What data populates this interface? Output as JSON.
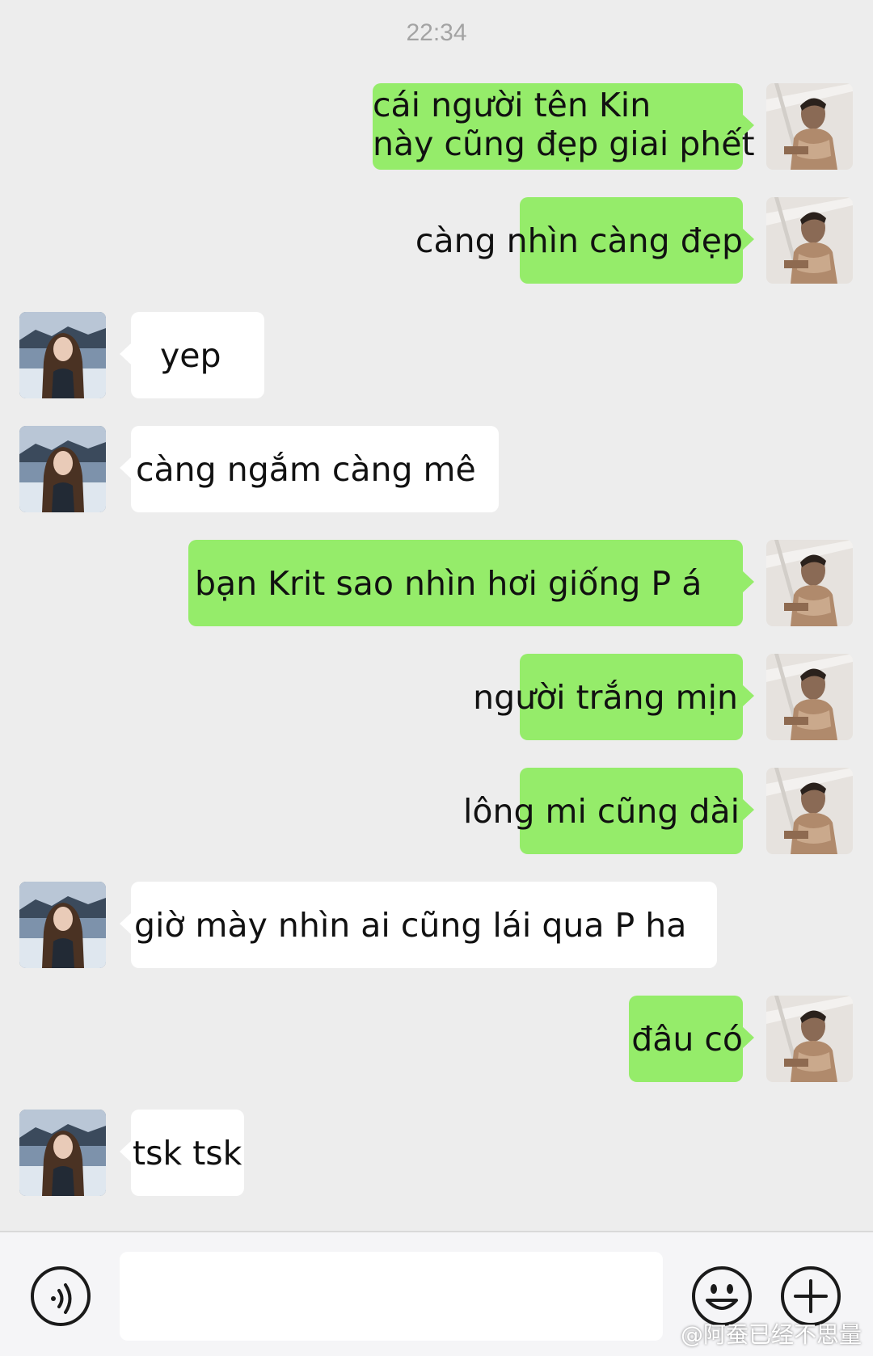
{
  "chat": {
    "timestamp": "22:34",
    "messages": [
      {
        "sender": "me",
        "lines": [
          "cái người tên Kin",
          "này cũng đẹp giai phết"
        ]
      },
      {
        "sender": "me",
        "text": "càng nhìn càng đẹp"
      },
      {
        "sender": "other",
        "text": "yep"
      },
      {
        "sender": "other",
        "text": "càng ngắm càng mê"
      },
      {
        "sender": "me",
        "text": "bạn Krit sao nhìn hơi giống P á"
      },
      {
        "sender": "me",
        "text": "người trắng mịn"
      },
      {
        "sender": "me",
        "text": "lông mi cũng dài"
      },
      {
        "sender": "other",
        "text": "giờ mày nhìn ai cũng lái qua P ha"
      },
      {
        "sender": "me",
        "text": "đâu có"
      },
      {
        "sender": "other",
        "text": "tsk tsk"
      }
    ]
  },
  "input_bar": {
    "voice_icon": "voice-icon",
    "emoji_icon": "emoji-icon",
    "plus_icon": "plus-icon",
    "input_value": ""
  },
  "watermark": {
    "text": "@阿蚕已经不思量"
  },
  "colors": {
    "background": "#ededed",
    "my_bubble": "#95ec6a",
    "their_bubble": "#ffffff"
  }
}
